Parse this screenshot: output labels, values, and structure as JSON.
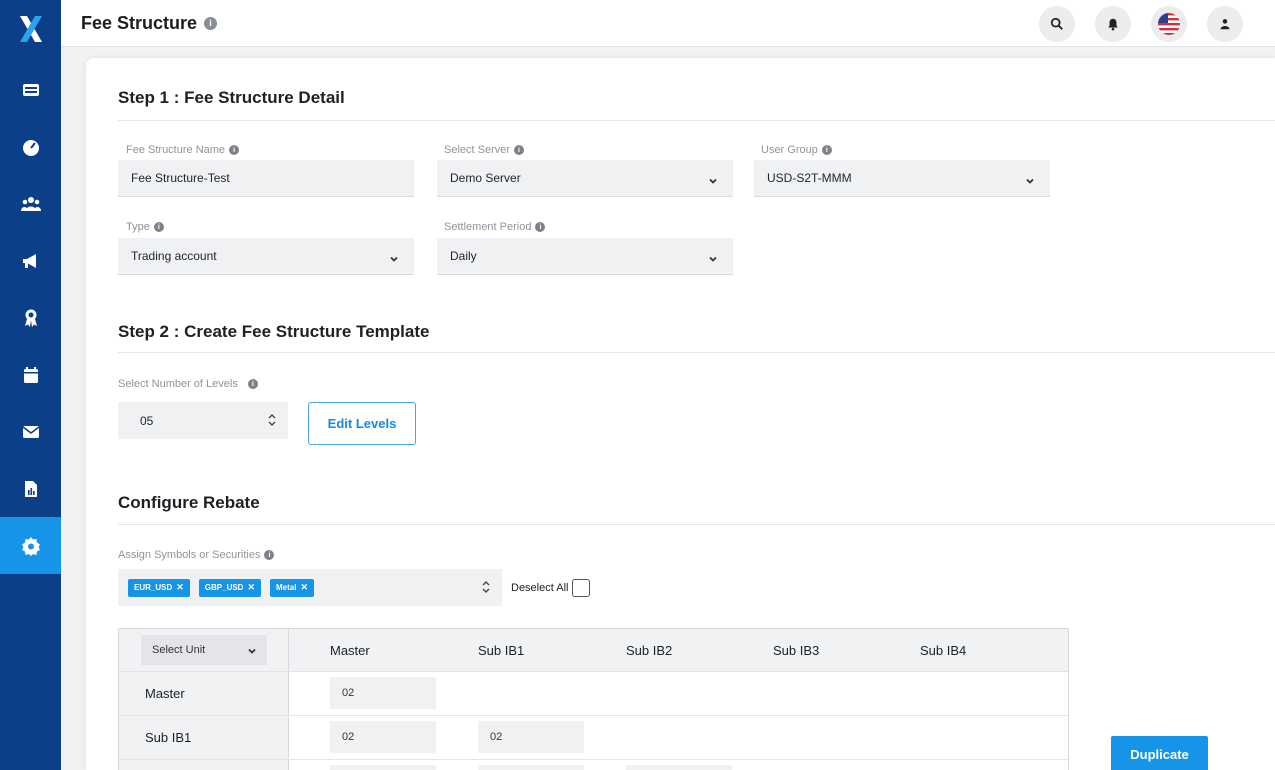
{
  "app": {
    "logo": "X"
  },
  "header": {
    "title": "Fee Structure"
  },
  "step1": {
    "title": "Step 1 : Fee Structure Detail",
    "fee_name": {
      "label": "Fee Structure Name",
      "value": "Fee Structure-Test"
    },
    "server": {
      "label": "Select Server",
      "value": "Demo Server"
    },
    "user_group": {
      "label": "User Group",
      "value": "USD-S2T-MMM"
    },
    "type": {
      "label": "Type",
      "value": "Trading account"
    },
    "settlement": {
      "label": "Settlement Period",
      "value": "Daily"
    }
  },
  "step2": {
    "title": "Step 2 : Create Fee Structure Template",
    "levels": {
      "label": "Select Number of Levels",
      "value": "05"
    },
    "edit_levels": "Edit Levels"
  },
  "rebate": {
    "title": "Configure Rebate",
    "symbols_label": "Assign Symbols or Securities",
    "tags": [
      "EUR_USD",
      "GBP_USD",
      "Metal"
    ],
    "deselect_all": "Deselect All",
    "select_unit": "Select Unit",
    "columns": [
      "Master",
      "Sub IB1",
      "Sub IB2",
      "Sub IB3",
      "Sub IB4"
    ],
    "rows": [
      {
        "label": "Master",
        "values": [
          "02"
        ]
      },
      {
        "label": "Sub IB1",
        "values": [
          "02",
          "02"
        ]
      },
      {
        "label": "",
        "values": [
          "",
          "",
          ""
        ]
      }
    ],
    "duplicate": "Duplicate"
  },
  "colors": {
    "sidebar": "#0b3f87",
    "accent": "#1694e8"
  }
}
